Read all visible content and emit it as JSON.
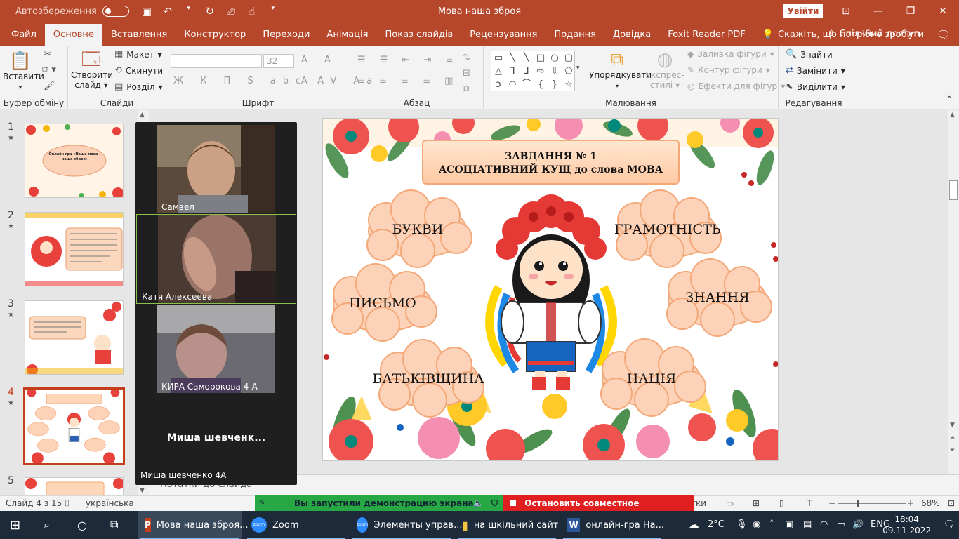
{
  "titlebar": {
    "autosave_label": "Автозбереження",
    "doc_title": "Мова наша зброя",
    "signin_label": "Увійти"
  },
  "tabs": [
    "Файл",
    "Основне",
    "Вставлення",
    "Конструктор",
    "Переходи",
    "Анімація",
    "Показ слайдів",
    "Рецензування",
    "Подання",
    "Довідка",
    "Foxit Reader PDF"
  ],
  "active_tab": "Основне",
  "tell_me": "Скажіть, що потрібно зробити",
  "share_label": "Спільний доступ",
  "ribbon": {
    "clipboard": {
      "paste": "Вставити",
      "group": "Буфер обміну"
    },
    "slides": {
      "new_slide_1": "Створити",
      "new_slide_2": "слайд",
      "layout": "Макет",
      "reset": "Скинути",
      "section": "Розділ",
      "group": "Слайди"
    },
    "font": {
      "size": "32",
      "group": "Шрифт"
    },
    "paragraph": {
      "group": "Абзац"
    },
    "drawing": {
      "arrange": "Упорядкувати",
      "quick_styles_1": "Експрес-",
      "quick_styles_2": "стилі",
      "fill": "Заливка фігури",
      "outline": "Контур фігури",
      "effects": "Ефекти для фігур",
      "group": "Малювання"
    },
    "editing": {
      "find": "Знайти",
      "replace": "Замінити",
      "select": "Виділити",
      "group": "Редагування"
    }
  },
  "thumbnails": [
    {
      "num": "1",
      "title": "Онлайн гра «Наша мова – наша зброя»"
    },
    {
      "num": "2"
    },
    {
      "num": "3"
    },
    {
      "num": "4"
    },
    {
      "num": "5"
    }
  ],
  "selected_slide": 4,
  "zoom": {
    "participants": [
      "Самвел",
      "Катя Алексеева",
      "КИРА Саморокова 4-А",
      "Миша шевченко 4А"
    ],
    "video_off_name": "Миша  шевченк..."
  },
  "slide": {
    "task_line1": "ЗАВДАННЯ № 1",
    "task_line2": "АСОЦІАТИВНИЙ КУЩ до слова МОВА",
    "clouds": [
      "БУКВИ",
      "ГРАМОТНІСТЬ",
      "ПИСЬМО",
      "ЗНАННЯ",
      "БАТЬКІВЩИНА",
      "НАЦІЯ"
    ]
  },
  "notes_placeholder": "Нотатки до слайда",
  "status": {
    "slide_of": "Слайд 4 з 15",
    "language": "українська",
    "share_notice": "Вы запустили демонстрацию экрана",
    "stop_share": "Остановить совместное использование",
    "tail": "тки",
    "zoom_level": "68%"
  },
  "taskbar": {
    "apps": [
      "Мова наша зброя...",
      "Zoom",
      "Элементы управ...",
      "на шкільний сайт",
      "онлайн-гра На..."
    ],
    "weather": "2°C",
    "lang": "ENG",
    "time": "18:04",
    "date": "09.11.2022"
  },
  "colors": {
    "accent": "#b7472a",
    "ribbon": "#f3f3f3",
    "taskbar": "#1c2a3a"
  }
}
